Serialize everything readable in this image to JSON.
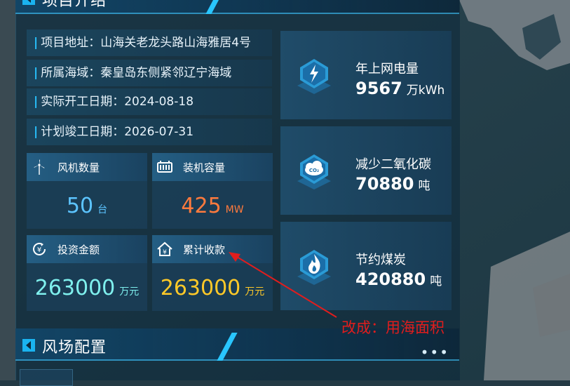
{
  "project_section": {
    "title": "项目介绍"
  },
  "info": [
    {
      "label": "项目地址",
      "value": "山海关老龙头路山海雅居4号"
    },
    {
      "label": "所属海域",
      "value": "秦皇岛东侧紧邻辽宁海域"
    },
    {
      "label": "实际开工日期",
      "value": "2024-08-18"
    },
    {
      "label": "计划竣工日期",
      "value": "2026-07-31"
    }
  ],
  "stats": [
    {
      "label": "风机数量",
      "value": "50",
      "unit": "台",
      "color": "#5cc4ff",
      "icon": "wind-turbine-icon"
    },
    {
      "label": "装机容量",
      "value": "425",
      "unit": "MW",
      "color": "#ff7a3d",
      "icon": "battery-capacity-icon"
    },
    {
      "label": "投资金额",
      "value": "263000",
      "unit": "万元",
      "color": "#7ff0ee",
      "icon": "yuan-refresh-icon"
    },
    {
      "label": "累计收款",
      "value": "263000",
      "unit": "万元",
      "color": "#ffc928",
      "icon": "house-yuan-icon"
    }
  ],
  "summary": [
    {
      "label": "年上网电量",
      "value": "9567",
      "unit": "万kWh",
      "icon": "lightning-icon"
    },
    {
      "label": "减少二氧化碳",
      "value": "70880",
      "unit": "吨",
      "icon": "co2-cloud-icon"
    },
    {
      "label": "节约煤炭",
      "value": "420880",
      "unit": "吨",
      "icon": "flame-icon"
    }
  ],
  "wind_config": {
    "title": "风场配置",
    "more_label": "•••"
  },
  "annotation": {
    "text": "改成：用海面积",
    "color": "#e11d1d"
  },
  "colors": {
    "accent": "#28c2ff",
    "panel_bg": "#0c283a"
  }
}
